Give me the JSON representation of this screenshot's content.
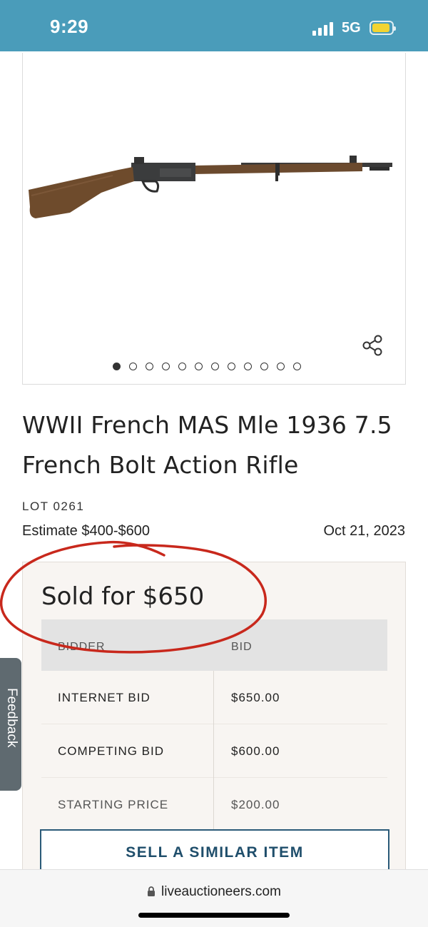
{
  "status_bar": {
    "time": "9:29",
    "network": "5G"
  },
  "gallery": {
    "total_images": 12,
    "active_index": 0
  },
  "lot": {
    "title": "WWII French MAS Mle 1936 7.5 French Bolt Action Rifle",
    "lot_number": "LOT 0261",
    "estimate": "Estimate $400-$600",
    "date": "Oct 21, 2023"
  },
  "result": {
    "sold_text": "Sold for $650",
    "headers": {
      "bidder": "BIDDER",
      "bid": "BID"
    },
    "rows": [
      {
        "bidder": "INTERNET BID",
        "bid": "$650.00"
      },
      {
        "bidder": "COMPETING BID",
        "bid": "$600.00"
      },
      {
        "bidder": "STARTING PRICE",
        "bid": "$200.00"
      }
    ]
  },
  "actions": {
    "sell_similar": "SELL A SIMILAR ITEM",
    "feedback": "Feedback"
  },
  "browser": {
    "url": "liveauctioneers.com"
  },
  "colors": {
    "status_bar": "#4a9cba",
    "button_text": "#1f4e6b",
    "annotation": "#c8281c",
    "panel": "#f8f5f2"
  }
}
